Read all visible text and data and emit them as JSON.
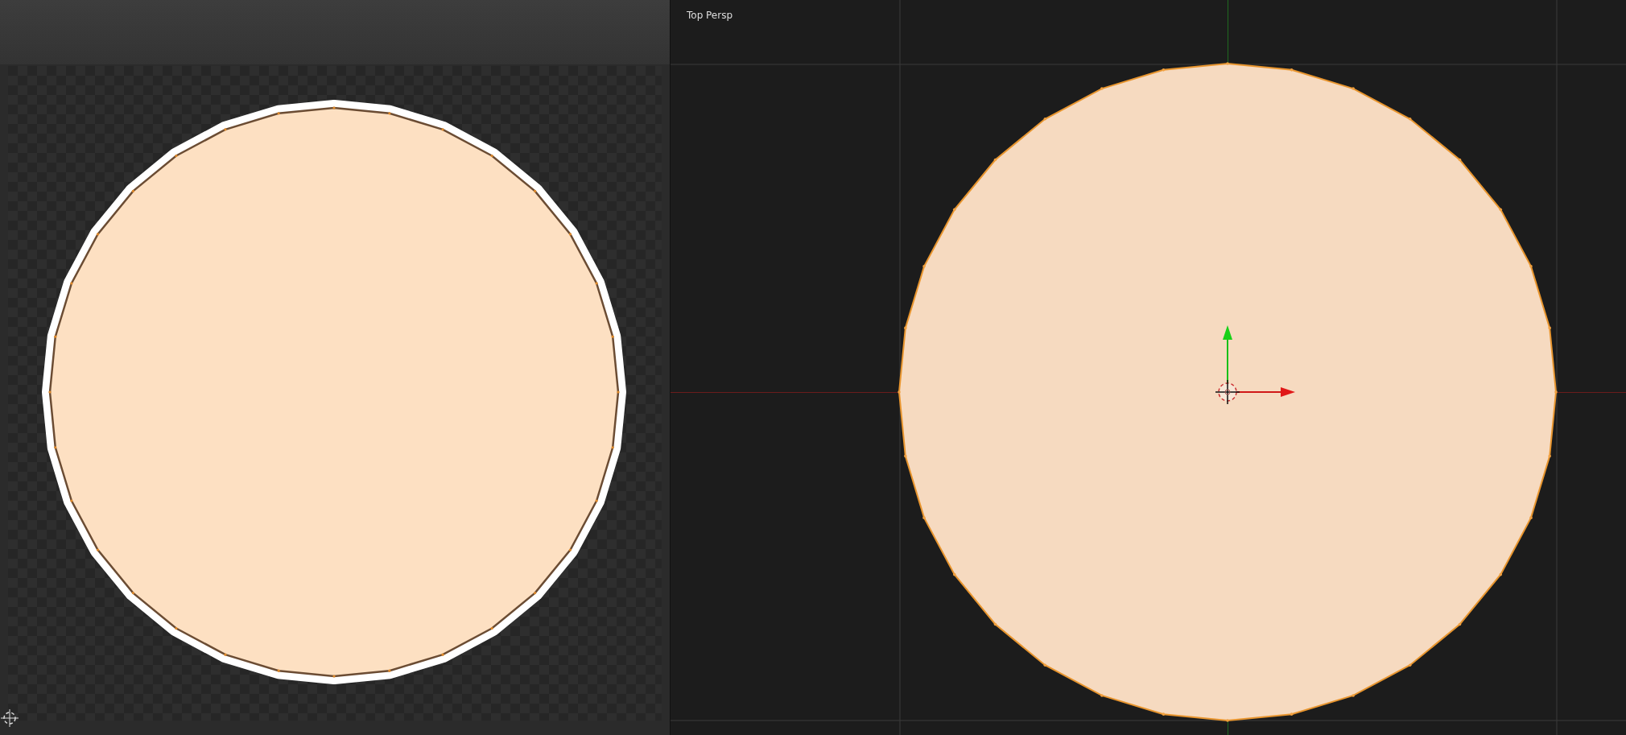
{
  "viewport": {
    "label": "Top Persp"
  }
}
